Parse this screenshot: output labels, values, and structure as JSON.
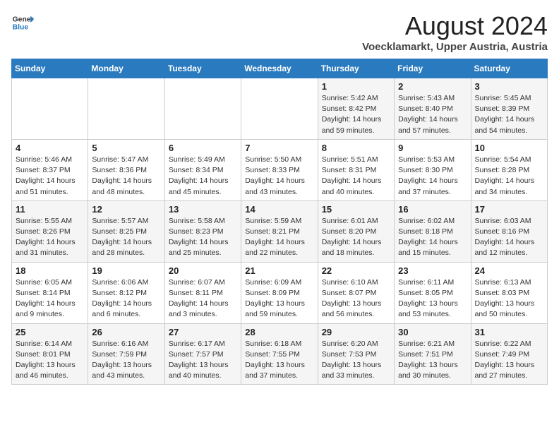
{
  "header": {
    "logo_text_line1": "General",
    "logo_text_line2": "Blue",
    "month_year": "August 2024",
    "location": "Voecklamarkt, Upper Austria, Austria"
  },
  "weekdays": [
    "Sunday",
    "Monday",
    "Tuesday",
    "Wednesday",
    "Thursday",
    "Friday",
    "Saturday"
  ],
  "weeks": [
    [
      {
        "day": "",
        "info": ""
      },
      {
        "day": "",
        "info": ""
      },
      {
        "day": "",
        "info": ""
      },
      {
        "day": "",
        "info": ""
      },
      {
        "day": "1",
        "info": "Sunrise: 5:42 AM\nSunset: 8:42 PM\nDaylight: 14 hours\nand 59 minutes."
      },
      {
        "day": "2",
        "info": "Sunrise: 5:43 AM\nSunset: 8:40 PM\nDaylight: 14 hours\nand 57 minutes."
      },
      {
        "day": "3",
        "info": "Sunrise: 5:45 AM\nSunset: 8:39 PM\nDaylight: 14 hours\nand 54 minutes."
      }
    ],
    [
      {
        "day": "4",
        "info": "Sunrise: 5:46 AM\nSunset: 8:37 PM\nDaylight: 14 hours\nand 51 minutes."
      },
      {
        "day": "5",
        "info": "Sunrise: 5:47 AM\nSunset: 8:36 PM\nDaylight: 14 hours\nand 48 minutes."
      },
      {
        "day": "6",
        "info": "Sunrise: 5:49 AM\nSunset: 8:34 PM\nDaylight: 14 hours\nand 45 minutes."
      },
      {
        "day": "7",
        "info": "Sunrise: 5:50 AM\nSunset: 8:33 PM\nDaylight: 14 hours\nand 43 minutes."
      },
      {
        "day": "8",
        "info": "Sunrise: 5:51 AM\nSunset: 8:31 PM\nDaylight: 14 hours\nand 40 minutes."
      },
      {
        "day": "9",
        "info": "Sunrise: 5:53 AM\nSunset: 8:30 PM\nDaylight: 14 hours\nand 37 minutes."
      },
      {
        "day": "10",
        "info": "Sunrise: 5:54 AM\nSunset: 8:28 PM\nDaylight: 14 hours\nand 34 minutes."
      }
    ],
    [
      {
        "day": "11",
        "info": "Sunrise: 5:55 AM\nSunset: 8:26 PM\nDaylight: 14 hours\nand 31 minutes."
      },
      {
        "day": "12",
        "info": "Sunrise: 5:57 AM\nSunset: 8:25 PM\nDaylight: 14 hours\nand 28 minutes."
      },
      {
        "day": "13",
        "info": "Sunrise: 5:58 AM\nSunset: 8:23 PM\nDaylight: 14 hours\nand 25 minutes."
      },
      {
        "day": "14",
        "info": "Sunrise: 5:59 AM\nSunset: 8:21 PM\nDaylight: 14 hours\nand 22 minutes."
      },
      {
        "day": "15",
        "info": "Sunrise: 6:01 AM\nSunset: 8:20 PM\nDaylight: 14 hours\nand 18 minutes."
      },
      {
        "day": "16",
        "info": "Sunrise: 6:02 AM\nSunset: 8:18 PM\nDaylight: 14 hours\nand 15 minutes."
      },
      {
        "day": "17",
        "info": "Sunrise: 6:03 AM\nSunset: 8:16 PM\nDaylight: 14 hours\nand 12 minutes."
      }
    ],
    [
      {
        "day": "18",
        "info": "Sunrise: 6:05 AM\nSunset: 8:14 PM\nDaylight: 14 hours\nand 9 minutes."
      },
      {
        "day": "19",
        "info": "Sunrise: 6:06 AM\nSunset: 8:12 PM\nDaylight: 14 hours\nand 6 minutes."
      },
      {
        "day": "20",
        "info": "Sunrise: 6:07 AM\nSunset: 8:11 PM\nDaylight: 14 hours\nand 3 minutes."
      },
      {
        "day": "21",
        "info": "Sunrise: 6:09 AM\nSunset: 8:09 PM\nDaylight: 13 hours\nand 59 minutes."
      },
      {
        "day": "22",
        "info": "Sunrise: 6:10 AM\nSunset: 8:07 PM\nDaylight: 13 hours\nand 56 minutes."
      },
      {
        "day": "23",
        "info": "Sunrise: 6:11 AM\nSunset: 8:05 PM\nDaylight: 13 hours\nand 53 minutes."
      },
      {
        "day": "24",
        "info": "Sunrise: 6:13 AM\nSunset: 8:03 PM\nDaylight: 13 hours\nand 50 minutes."
      }
    ],
    [
      {
        "day": "25",
        "info": "Sunrise: 6:14 AM\nSunset: 8:01 PM\nDaylight: 13 hours\nand 46 minutes."
      },
      {
        "day": "26",
        "info": "Sunrise: 6:16 AM\nSunset: 7:59 PM\nDaylight: 13 hours\nand 43 minutes."
      },
      {
        "day": "27",
        "info": "Sunrise: 6:17 AM\nSunset: 7:57 PM\nDaylight: 13 hours\nand 40 minutes."
      },
      {
        "day": "28",
        "info": "Sunrise: 6:18 AM\nSunset: 7:55 PM\nDaylight: 13 hours\nand 37 minutes."
      },
      {
        "day": "29",
        "info": "Sunrise: 6:20 AM\nSunset: 7:53 PM\nDaylight: 13 hours\nand 33 minutes."
      },
      {
        "day": "30",
        "info": "Sunrise: 6:21 AM\nSunset: 7:51 PM\nDaylight: 13 hours\nand 30 minutes."
      },
      {
        "day": "31",
        "info": "Sunrise: 6:22 AM\nSunset: 7:49 PM\nDaylight: 13 hours\nand 27 minutes."
      }
    ]
  ]
}
